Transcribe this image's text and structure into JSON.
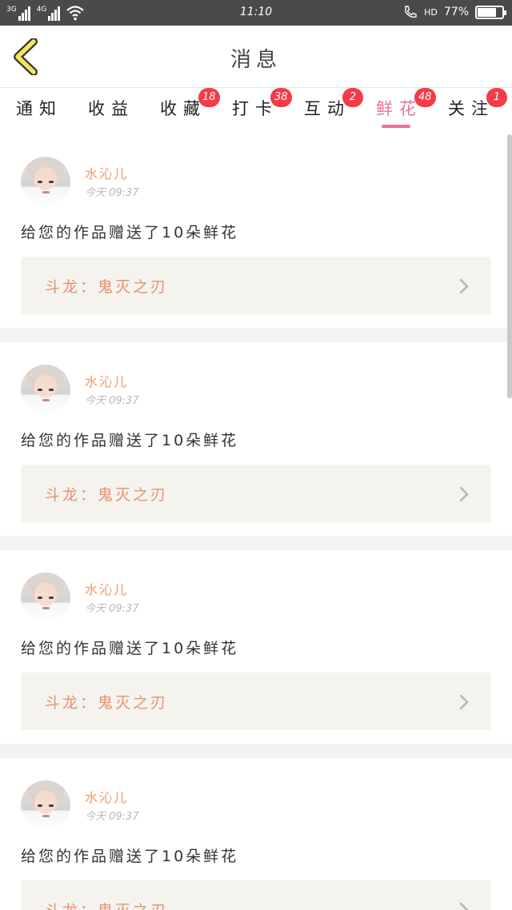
{
  "status_bar": {
    "net1": "3G",
    "net2": "4G",
    "time": "11:10",
    "hd": "HD",
    "battery": "77%",
    "battery_level": 0.77
  },
  "header": {
    "title": "消息"
  },
  "tabs": [
    {
      "label": "通知",
      "badge": ""
    },
    {
      "label": "收益",
      "badge": ""
    },
    {
      "label": "收藏",
      "badge": "18"
    },
    {
      "label": "打卡",
      "badge": "38"
    },
    {
      "label": "互动",
      "badge": "2"
    },
    {
      "label": "鲜花",
      "badge": "48",
      "active": true
    },
    {
      "label": "关注",
      "badge": "1"
    }
  ],
  "colors": {
    "accent": "#e8739a",
    "badge": "#f23d48",
    "username": "#e89a6b",
    "work_title": "#e8926a",
    "work_box_bg": "#f4f3ee"
  },
  "feed": [
    {
      "username": "水沁儿",
      "time": "今天 09:37",
      "message": "给您的作品赠送了10朵鲜花",
      "work_title": "斗龙：鬼灭之刃"
    },
    {
      "username": "水沁儿",
      "time": "今天 09:37",
      "message": "给您的作品赠送了10朵鲜花",
      "work_title": "斗龙：鬼灭之刃"
    },
    {
      "username": "水沁儿",
      "time": "今天 09:37",
      "message": "给您的作品赠送了10朵鲜花",
      "work_title": "斗龙：鬼灭之刃"
    },
    {
      "username": "水沁儿",
      "time": "今天 09:37",
      "message": "给您的作品赠送了10朵鲜花",
      "work_title": "斗龙：鬼灭之刃"
    }
  ]
}
